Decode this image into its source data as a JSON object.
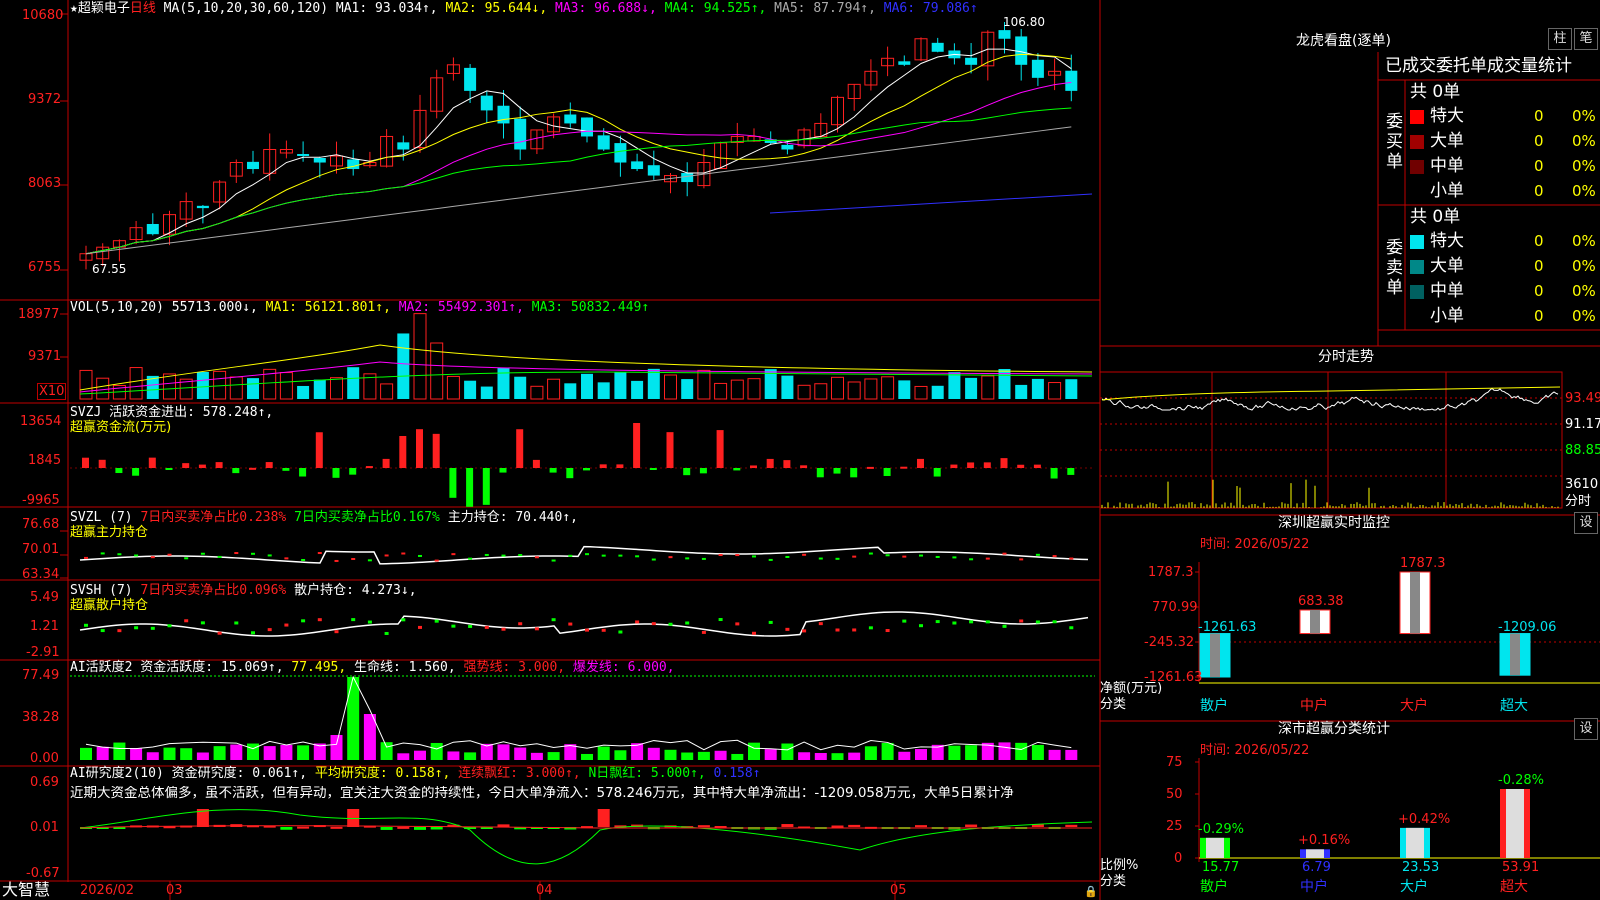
{
  "stock": {
    "name": "超颖电子",
    "period": "日线"
  },
  "colors": {
    "up": "#ff2020",
    "down": "#00e5ee",
    "frame": "#c00000",
    "grid": "#7a0000",
    "white": "#ffffff",
    "yellow": "#ffff00",
    "magenta": "#ff00ff",
    "green": "#00ff00",
    "gray": "#aaaaaa",
    "blue": "#3030ff"
  },
  "main": {
    "legend": [
      {
        "text": "★",
        "color": "#ffffff"
      },
      {
        "text": "超颖电子",
        "color": "#ffffff"
      },
      {
        "text": "日线",
        "color": "#ff2020"
      },
      {
        "text": " MA(5,10,20,30,60,120) ",
        "color": "#ffffff"
      },
      {
        "text": "MA1: 93.034↑,",
        "color": "#ffffff"
      },
      {
        "text": " MA2: 95.644↓,",
        "color": "#ffff00"
      },
      {
        "text": " MA3: 96.688↓,",
        "color": "#ff00ff"
      },
      {
        "text": " MA4: 94.525↑,",
        "color": "#00ff00"
      },
      {
        "text": " MA5: 87.794↑,",
        "color": "#aaaaaa"
      },
      {
        "text": " MA6: 79.086↑",
        "color": "#3030ff"
      }
    ],
    "price_labels": [
      "10680",
      "9372",
      "8063",
      "6755"
    ],
    "high_label": "106.80",
    "low_label": "67.55"
  },
  "vol": {
    "legend": [
      {
        "text": "VOL(5,10,20) ",
        "color": "#ffffff"
      },
      {
        "text": "55713.000↓,",
        "color": "#ffffff"
      },
      {
        "text": " MA1: 56121.801↑,",
        "color": "#ffff00"
      },
      {
        "text": " MA2: 55492.301↑,",
        "color": "#ff00ff"
      },
      {
        "text": " MA3: 50832.449↑",
        "color": "#00ff00"
      }
    ],
    "labels": [
      "18977",
      "9371"
    ],
    "unit": "X10"
  },
  "svzj": {
    "legend": [
      {
        "text": "SVZJ  活跃资金进出: 578.248↑,",
        "color": "#ffffff"
      }
    ],
    "sub": "超赢资金流(万元)",
    "labels": [
      "13654",
      "1845",
      "-9965"
    ]
  },
  "svzl": {
    "legend": [
      {
        "text": "SVZL (7) ",
        "color": "#ffffff"
      },
      {
        "text": "7日内买卖净占比0.238%",
        "color": "#ff2020"
      },
      {
        "text": " 7日内买卖净占比0.167%",
        "color": "#00ff00"
      },
      {
        "text": " 主力持仓: 70.440↑,",
        "color": "#ffffff"
      }
    ],
    "sub": "超赢主力持仓",
    "labels": [
      "76.68",
      "70.01",
      "63.34"
    ]
  },
  "svsh": {
    "legend": [
      {
        "text": "SVSH (7) ",
        "color": "#ffffff"
      },
      {
        "text": "7日内买卖净占比0.096%",
        "color": "#ff2020"
      },
      {
        "text": " 散户持仓: 4.273↓,",
        "color": "#ffffff"
      }
    ],
    "sub": "超赢散户持仓",
    "labels": [
      "5.49",
      "1.21",
      "-2.91"
    ]
  },
  "ai2": {
    "legend": [
      {
        "text": "AI活跃度2 资金活跃度: 15.069↑,",
        "color": "#ffffff"
      },
      {
        "text": " 77.495,",
        "color": "#ffff00"
      },
      {
        "text": " 生命线: 1.560,",
        "color": "#ffffff"
      },
      {
        "text": " 强势线: 3.000,",
        "color": "#ff2020"
      },
      {
        "text": " 爆发线: 6.000,",
        "color": "#ff00ff"
      }
    ],
    "labels": [
      "77.49",
      "38.28",
      "0.00"
    ]
  },
  "ai_research": {
    "legend": [
      {
        "text": "AI研究度2(10) 资金研究度: 0.061↑,",
        "color": "#ffffff"
      },
      {
        "text": " 平均研究度: 0.158↑,",
        "color": "#ffff00"
      },
      {
        "text": " 连续飘红: 3.000↑,",
        "color": "#ff2020"
      },
      {
        "text": " N日飘红: 5.000↑,",
        "color": "#00ff00"
      },
      {
        "text": " 0.158↑",
        "color": "#3030ff"
      }
    ],
    "comment": "近期大资金总体偏多，虽不活跃，但有异动，宜关注大资金的持续性，今日大单净流入：578.246万元，其中特大单净流出：-1209.058万元，大单5日累计净",
    "labels": [
      "0.69",
      "0.01",
      "-0.67"
    ]
  },
  "date_axis": {
    "brand": "大智慧",
    "labels": [
      "2026/02",
      "03",
      "04",
      "05"
    ]
  },
  "right": {
    "buttons": [
      "柱",
      "笔"
    ],
    "title": "龙虎看盘(逐单)",
    "tabs": [
      "已成交",
      "委托单",
      "成交量统计"
    ],
    "buy": {
      "label": "委买单",
      "total": "共 0单",
      "rows": [
        {
          "name": "特大",
          "count": "0",
          "pct": "0%",
          "color": "#ff0000"
        },
        {
          "name": "大单",
          "count": "0",
          "pct": "0%",
          "color": "#a00000"
        },
        {
          "name": "中单",
          "count": "0",
          "pct": "0%",
          "color": "#700000"
        },
        {
          "name": "小单",
          "count": "0",
          "pct": "0%",
          "color": "#000000"
        }
      ]
    },
    "sell": {
      "label": "委卖单",
      "total": "共 0单",
      "rows": [
        {
          "name": "特大",
          "count": "0",
          "pct": "0%",
          "color": "#00e5ee"
        },
        {
          "name": "大单",
          "count": "0",
          "pct": "0%",
          "color": "#008888"
        },
        {
          "name": "中单",
          "count": "0",
          "pct": "0%",
          "color": "#006060"
        },
        {
          "name": "小单",
          "count": "0",
          "pct": "0%",
          "color": "#000000"
        }
      ]
    },
    "intraday": {
      "title": "分时走势",
      "labels": [
        "93.49",
        "91.17",
        "88.85"
      ],
      "vol_label": "3610",
      "vol_unit": "分时"
    },
    "monitor": {
      "title": "深圳超赢实时监控",
      "btn": "设",
      "time": "时间: 2026/05/22",
      "labels": [
        "1787.3",
        "770.99",
        "-245.32",
        "-1261.63"
      ],
      "ylabel": "净额(万元)",
      "xlabel": "分类"
    },
    "classify": {
      "title": "深市超赢分类统计",
      "btn": "设",
      "time": "时间: 2026/05/22",
      "labels": [
        "75",
        "50",
        "25",
        "0"
      ],
      "ylabel": "比例%",
      "xlabel": "分类"
    }
  },
  "chart_data": [
    {
      "type": "bar",
      "title": "深圳超赢实时监控",
      "categories": [
        "散户",
        "中户",
        "大户",
        "超大"
      ],
      "values": [
        -1261.63,
        683.38,
        1787.3,
        -1209.06
      ],
      "ylabel": "净额(万元)",
      "ylim": [
        -1261.63,
        1787.3
      ]
    },
    {
      "type": "bar",
      "title": "深市超赢分类统计",
      "categories": [
        "散户",
        "中户",
        "大户",
        "超大"
      ],
      "values": [
        15.77,
        6.79,
        23.53,
        53.91
      ],
      "changes": [
        "-0.29%",
        "+0.16%",
        "+0.42%",
        "-0.28%"
      ],
      "ylabel": "比例%",
      "ylim": [
        0,
        75
      ]
    }
  ]
}
